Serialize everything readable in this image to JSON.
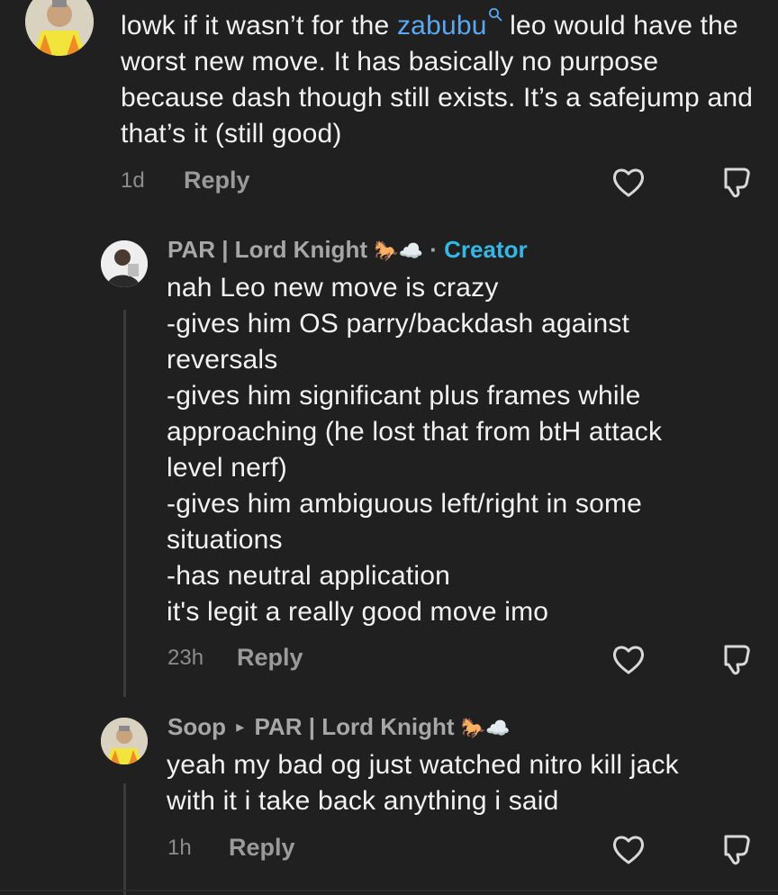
{
  "comments": [
    {
      "text_before": "lowk if it wasn’t for the ",
      "mention": "zabubu",
      "text_after": " leo would have the worst new move. It has basically no purpose because dash though still exists. It’s a safejump and that’s it (still good)",
      "time": "1d",
      "reply_label": "Reply"
    },
    {
      "username": "PAR | Lord Knight",
      "emojis": "🐎☁️",
      "separator": "·",
      "badge": "Creator",
      "lines": [
        "nah Leo new move is crazy",
        "-gives him OS parry/backdash against",
        "reversals",
        "-gives him significant plus frames while",
        "approaching (he lost that from btH attack",
        "level nerf)",
        "-gives him ambiguous left/right in some",
        "situations",
        "-has neutral application",
        "it's legit a really good move imo"
      ],
      "time": "23h",
      "reply_label": "Reply"
    },
    {
      "username": "Soop",
      "arrow": "▸",
      "reply_to": "PAR | Lord Knight",
      "emojis": "🐎☁️",
      "lines": [
        "yeah my bad og just watched nitro kill jack",
        "with it i take back anything i said"
      ],
      "time": "1h",
      "reply_label": "Reply"
    }
  ],
  "icons": {
    "like": "heart-outline-icon",
    "dislike": "thumbs-down-outline-icon",
    "search": "search-icon"
  },
  "colors": {
    "background": "#202020",
    "mention": "#58a8f2",
    "creator": "#36b6e4"
  }
}
